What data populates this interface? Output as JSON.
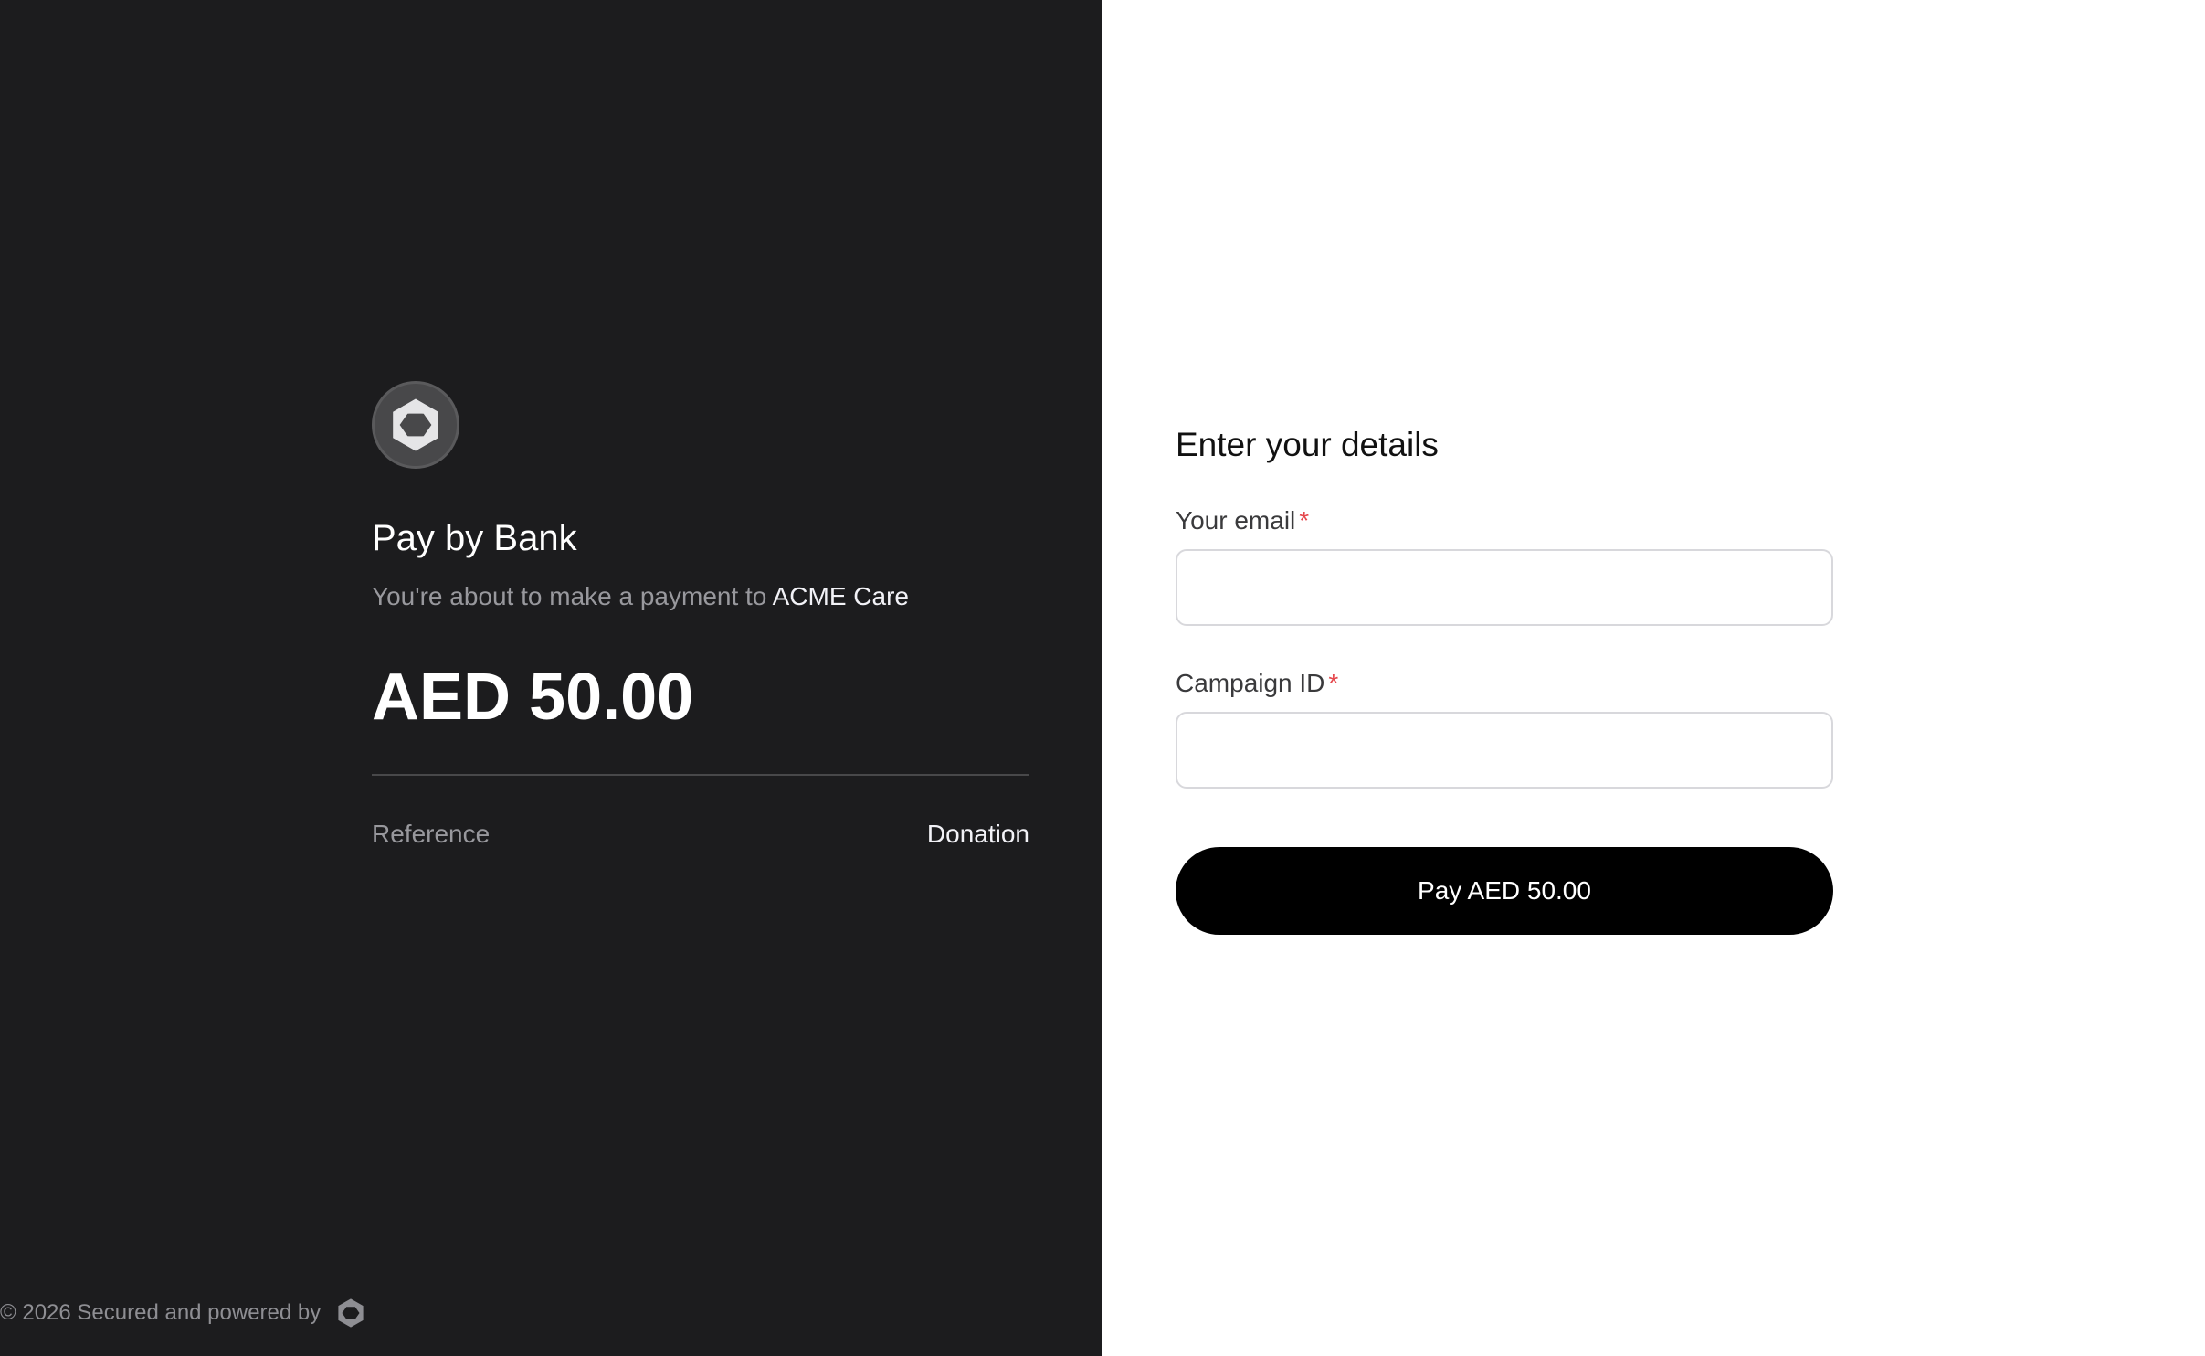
{
  "left_panel": {
    "brand_title": "Pay by Bank",
    "subtitle_prefix": "You're about to make a payment to",
    "merchant_name": "ACME Care",
    "amount": "AED 50.00",
    "reference_label": "Reference",
    "reference_value": "Donation",
    "footer_text": "© 2026 Secured and powered by",
    "logo_icon": "hexagon-logo-icon",
    "background_color": "#1c1c1e"
  },
  "form": {
    "title": "Enter your details",
    "email_label": "Your email",
    "email_value": "",
    "campaign_label": "Campaign ID",
    "campaign_value": "",
    "required_marker": "*",
    "pay_button_label": "Pay AED 50.00",
    "required_color": "#e5484d",
    "button_color": "#000000"
  }
}
